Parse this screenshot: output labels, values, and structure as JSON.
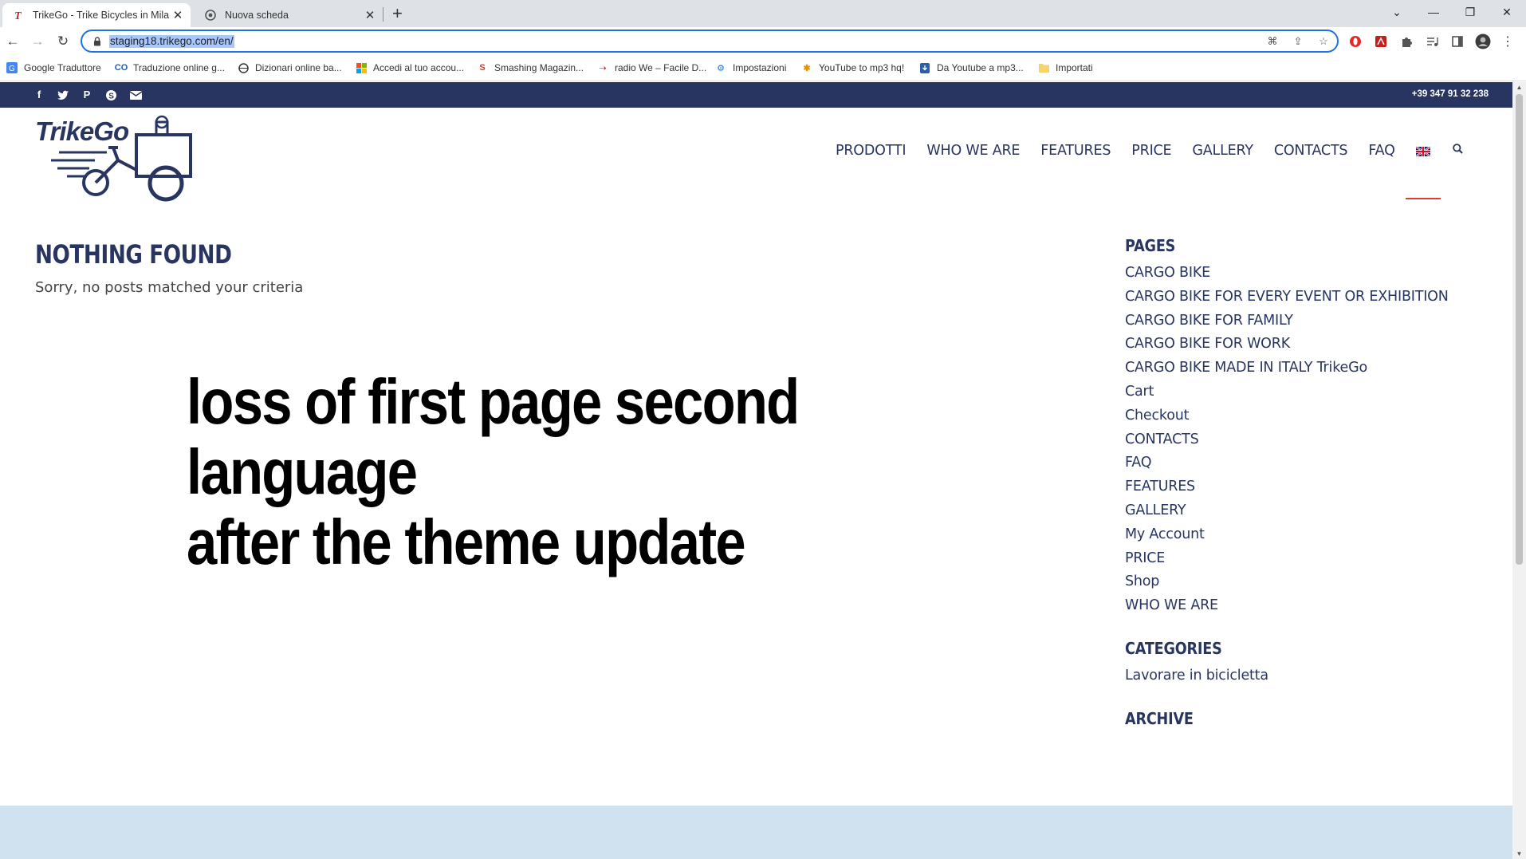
{
  "browser": {
    "tabs": [
      {
        "title": "TrikeGo - Trike Bicycles in Milano",
        "active": true
      },
      {
        "title": "Nuova scheda",
        "active": false
      }
    ],
    "url": "staging18.trikego.com/en/",
    "bookmarks": [
      "Google Traduttore",
      "Traduzione online g...",
      "Dizionari online ba...",
      "Accedi al tuo accou...",
      "Smashing Magazin...",
      "radio We – Facile D...",
      "Impostazioni",
      "YouTube to mp3 hq!",
      "Da Youtube a mp3...",
      "Importati"
    ]
  },
  "site": {
    "logo_text": "TrikeGo",
    "phone": "+39 347 91 32 238",
    "nav": [
      "PRODOTTI",
      "WHO WE ARE",
      "FEATURES",
      "PRICE",
      "GALLERY",
      "CONTACTS",
      "FAQ"
    ],
    "colors": {
      "navy": "#283561",
      "accent": "#e03c31"
    }
  },
  "main": {
    "title": "NOTHING FOUND",
    "message": "Sorry, no posts matched your criteria",
    "annotation_line1": "loss of first page second language",
    "annotation_line2": "after the theme update"
  },
  "sidebar": {
    "pages_heading": "PAGES",
    "pages": [
      "CARGO BIKE",
      "CARGO BIKE FOR EVERY EVENT OR EXHIBITION",
      "CARGO BIKE FOR FAMILY",
      "CARGO BIKE FOR WORK",
      "CARGO BIKE MADE IN ITALY TrikeGo",
      "Cart",
      "Checkout",
      "CONTACTS",
      "FAQ",
      "FEATURES",
      "GALLERY",
      "My Account",
      "PRICE",
      "Shop",
      "WHO WE ARE"
    ],
    "categories_heading": "CATEGORIES",
    "categories": [
      "Lavorare in bicicletta"
    ],
    "archive_heading": "ARCHIVE"
  }
}
